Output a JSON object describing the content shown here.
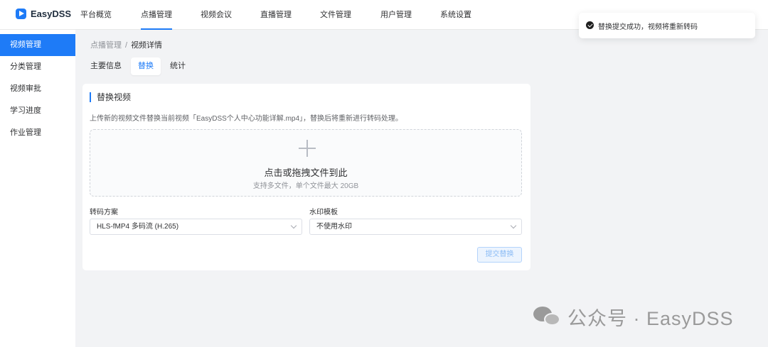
{
  "app": {
    "name": "EasyDSS"
  },
  "nav": {
    "items": [
      {
        "label": "平台概览"
      },
      {
        "label": "点播管理"
      },
      {
        "label": "视频会议"
      },
      {
        "label": "直播管理"
      },
      {
        "label": "文件管理"
      },
      {
        "label": "用户管理"
      },
      {
        "label": "系统设置"
      }
    ],
    "active": "点播管理"
  },
  "sidebar": {
    "items": [
      {
        "label": "视频管理"
      },
      {
        "label": "分类管理"
      },
      {
        "label": "视频审批"
      },
      {
        "label": "学习进度"
      },
      {
        "label": "作业管理"
      }
    ],
    "active": "视频管理"
  },
  "breadcrumb": {
    "parent": "点播管理",
    "separator": "/",
    "current": "视频详情"
  },
  "tabs": [
    {
      "label": "主要信息"
    },
    {
      "label": "替换"
    },
    {
      "label": "统计"
    }
  ],
  "replace": {
    "title": "替换视频",
    "description": "上传新的视频文件替换当前视频「EasyDSS个人中心功能详解.mp4」，替换后将重新进行转码处理。",
    "dropzone": {
      "main": "点击或拖拽文件到此",
      "sub": "支持多文件，单个文件最大 20GB"
    },
    "transcode": {
      "label": "转码方案",
      "value": "HLS-fMP4 多码流 (H.265)"
    },
    "watermark": {
      "label": "水印模板",
      "value": "不使用水印"
    },
    "submit_label": "提交替换"
  },
  "toast": {
    "text": "替换提交成功，视频将重新转码"
  },
  "page_watermark": {
    "text": "公众号 · EasyDSS"
  },
  "colors": {
    "accent": "#1e7bf7",
    "page_bg": "#f2f3f5"
  }
}
